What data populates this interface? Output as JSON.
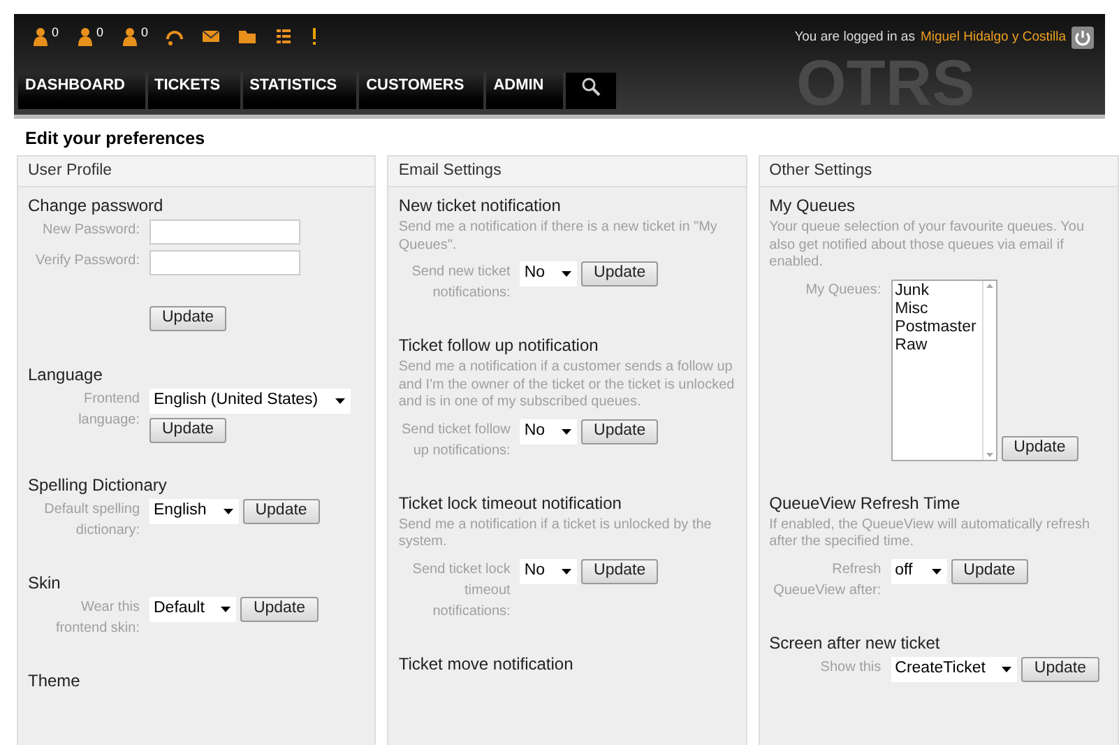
{
  "toolbar": {
    "counters": [
      "0",
      "0",
      "0"
    ],
    "logo": "OTRS",
    "login_text": "You are logged in as",
    "user_name": "Miguel Hidalgo y Costilla"
  },
  "nav": [
    {
      "label": "DASHBOARD"
    },
    {
      "label": "TICKETS"
    },
    {
      "label": "STATISTICS"
    },
    {
      "label": "CUSTOMERS"
    },
    {
      "label": "ADMIN"
    }
  ],
  "page_title": "Edit your preferences",
  "columns": [
    {
      "title": "User Profile",
      "sections": [
        {
          "title": "Change password",
          "fields": [
            {
              "kind": "password",
              "label": "New Password:"
            },
            {
              "kind": "password",
              "label": "Verify Password:"
            }
          ],
          "button": "Update"
        },
        {
          "title": "Language",
          "fields": [
            {
              "kind": "select",
              "label": "Frontend language:",
              "value": "English (United States)"
            }
          ],
          "button": "Update"
        },
        {
          "title": "Spelling Dictionary",
          "fields": [
            {
              "kind": "select",
              "label": "Default spelling dictionary:",
              "value": "English"
            }
          ],
          "button": "Update"
        },
        {
          "title": "Skin",
          "fields": [
            {
              "kind": "select",
              "label": "Wear this frontend skin:",
              "value": "Default"
            }
          ],
          "button": "Update"
        },
        {
          "title": "Theme"
        }
      ]
    },
    {
      "title": "Email Settings",
      "sections": [
        {
          "title": "New ticket notification",
          "description": "Send me a notification if there is a new ticket in \"My Queues\".",
          "fields": [
            {
              "kind": "select",
              "label": "Send new ticket notifications:",
              "value": "No"
            }
          ],
          "button": "Update"
        },
        {
          "title": "Ticket follow up notification",
          "description": "Send me a notification if a customer sends a follow up and I'm the owner of the ticket or the ticket is unlocked and is in one of my subscribed queues.",
          "fields": [
            {
              "kind": "select",
              "label": "Send ticket follow up notifications:",
              "value": "No"
            }
          ],
          "button": "Update"
        },
        {
          "title": "Ticket lock timeout notification",
          "description": "Send me a notification if a ticket is unlocked by the system.",
          "fields": [
            {
              "kind": "select",
              "label": "Send ticket lock timeout notifications:",
              "value": "No"
            }
          ],
          "button": "Update"
        },
        {
          "title": "Ticket move notification"
        }
      ]
    },
    {
      "title": "Other Settings",
      "sections": [
        {
          "title": "My Queues",
          "description": "Your queue selection of your favourite queues. You also get notified about those queues via email if enabled.",
          "fields": [
            {
              "kind": "listbox",
              "label": "My Queues:",
              "options": [
                "Junk",
                "Misc",
                "Postmaster",
                "Raw"
              ]
            }
          ],
          "button": "Update"
        },
        {
          "title": "QueueView Refresh Time",
          "description": "If enabled, the QueueView will automatically refresh after the specified time.",
          "fields": [
            {
              "kind": "select",
              "label": "Refresh QueueView after:",
              "value": "off"
            }
          ],
          "button": "Update"
        },
        {
          "title": "Screen after new ticket",
          "fields": [
            {
              "kind": "select",
              "label": "Show this",
              "value": "CreateTicket"
            }
          ],
          "button": "Update"
        }
      ]
    }
  ]
}
